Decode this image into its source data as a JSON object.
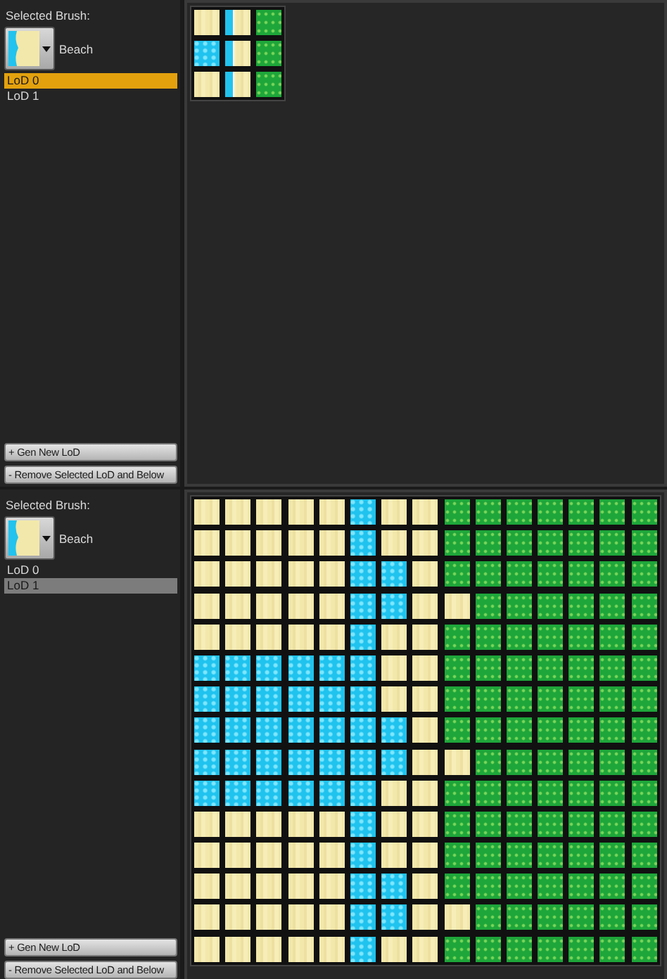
{
  "panels": [
    {
      "list_focused": true,
      "brush_label": "Selected Brush:",
      "brush": {
        "name": "Beach"
      },
      "lods": [
        {
          "label": "LoD 0",
          "selected": true
        },
        {
          "label": "LoD 1",
          "selected": false
        }
      ],
      "buttons": [
        "+ Gen New LoD",
        "- Remove Selected LoD and Below"
      ],
      "grid": [
        [
          {
            "kind": "sand"
          },
          {
            "kind": "beach"
          },
          {
            "kind": "grass"
          }
        ],
        [
          {
            "kind": "water"
          },
          {
            "kind": "beach"
          },
          {
            "kind": "grass"
          }
        ],
        [
          {
            "kind": "sand"
          },
          {
            "kind": "beach"
          },
          {
            "kind": "grass"
          }
        ]
      ]
    },
    {
      "list_focused": false,
      "brush_label": "Selected Brush:",
      "brush": {
        "name": "Beach"
      },
      "lods": [
        {
          "label": "LoD 0",
          "selected": false
        },
        {
          "label": "LoD 1",
          "selected": true
        }
      ],
      "buttons": [
        "+ Gen New LoD",
        "- Remove Selected LoD and Below"
      ],
      "grid": [
        [
          {
            "kind": "sand"
          },
          {
            "kind": "sand"
          },
          {
            "kind": "sand"
          },
          {
            "kind": "sand"
          },
          {
            "kind": "sand"
          },
          {
            "kind": "water"
          },
          {
            "kind": "sand"
          },
          {
            "kind": "sand"
          },
          {
            "kind": "grass"
          },
          {
            "kind": "grass"
          },
          {
            "kind": "grass"
          },
          {
            "kind": "grass"
          },
          {
            "kind": "grass"
          },
          {
            "kind": "grass"
          },
          {
            "kind": "grass"
          }
        ],
        [
          {
            "kind": "sand"
          },
          {
            "kind": "sand"
          },
          {
            "kind": "sand"
          },
          {
            "kind": "sand"
          },
          {
            "kind": "sand"
          },
          {
            "kind": "water"
          },
          {
            "kind": "sand"
          },
          {
            "kind": "sand"
          },
          {
            "kind": "grass"
          },
          {
            "kind": "grass"
          },
          {
            "kind": "grass"
          },
          {
            "kind": "grass"
          },
          {
            "kind": "grass"
          },
          {
            "kind": "grass"
          },
          {
            "kind": "grass"
          }
        ],
        [
          {
            "kind": "sand"
          },
          {
            "kind": "sand"
          },
          {
            "kind": "sand"
          },
          {
            "kind": "sand"
          },
          {
            "kind": "sand"
          },
          {
            "kind": "water"
          },
          {
            "kind": "water"
          },
          {
            "kind": "sand"
          },
          {
            "kind": "grass"
          },
          {
            "kind": "grass"
          },
          {
            "kind": "grass"
          },
          {
            "kind": "grass"
          },
          {
            "kind": "grass"
          },
          {
            "kind": "grass"
          },
          {
            "kind": "grass"
          }
        ],
        [
          {
            "kind": "sand"
          },
          {
            "kind": "sand"
          },
          {
            "kind": "sand"
          },
          {
            "kind": "sand"
          },
          {
            "kind": "sand"
          },
          {
            "kind": "water"
          },
          {
            "kind": "water"
          },
          {
            "kind": "sand"
          },
          {
            "kind": "sand"
          },
          {
            "kind": "grass"
          },
          {
            "kind": "grass"
          },
          {
            "kind": "grass"
          },
          {
            "kind": "grass"
          },
          {
            "kind": "grass"
          },
          {
            "kind": "grass"
          }
        ],
        [
          {
            "kind": "sand"
          },
          {
            "kind": "sand"
          },
          {
            "kind": "sand"
          },
          {
            "kind": "sand"
          },
          {
            "kind": "sand"
          },
          {
            "kind": "water"
          },
          {
            "kind": "sand"
          },
          {
            "kind": "sand"
          },
          {
            "kind": "grass"
          },
          {
            "kind": "grass"
          },
          {
            "kind": "grass"
          },
          {
            "kind": "grass"
          },
          {
            "kind": "grass"
          },
          {
            "kind": "grass"
          },
          {
            "kind": "grass"
          }
        ],
        [
          {
            "kind": "water"
          },
          {
            "kind": "water"
          },
          {
            "kind": "water"
          },
          {
            "kind": "water"
          },
          {
            "kind": "water"
          },
          {
            "kind": "water"
          },
          {
            "kind": "sand"
          },
          {
            "kind": "sand"
          },
          {
            "kind": "grass"
          },
          {
            "kind": "grass"
          },
          {
            "kind": "grass"
          },
          {
            "kind": "grass"
          },
          {
            "kind": "grass"
          },
          {
            "kind": "grass"
          },
          {
            "kind": "grass"
          }
        ],
        [
          {
            "kind": "water"
          },
          {
            "kind": "water"
          },
          {
            "kind": "water"
          },
          {
            "kind": "water"
          },
          {
            "kind": "water"
          },
          {
            "kind": "water"
          },
          {
            "kind": "sand"
          },
          {
            "kind": "sand"
          },
          {
            "kind": "grass"
          },
          {
            "kind": "grass"
          },
          {
            "kind": "grass"
          },
          {
            "kind": "grass"
          },
          {
            "kind": "grass"
          },
          {
            "kind": "grass"
          },
          {
            "kind": "grass"
          }
        ],
        [
          {
            "kind": "water"
          },
          {
            "kind": "water"
          },
          {
            "kind": "water"
          },
          {
            "kind": "water"
          },
          {
            "kind": "water"
          },
          {
            "kind": "water"
          },
          {
            "kind": "water"
          },
          {
            "kind": "sand"
          },
          {
            "kind": "grass"
          },
          {
            "kind": "grass"
          },
          {
            "kind": "grass"
          },
          {
            "kind": "grass"
          },
          {
            "kind": "grass"
          },
          {
            "kind": "grass"
          },
          {
            "kind": "grass"
          }
        ],
        [
          {
            "kind": "water"
          },
          {
            "kind": "water"
          },
          {
            "kind": "water"
          },
          {
            "kind": "water"
          },
          {
            "kind": "water"
          },
          {
            "kind": "water"
          },
          {
            "kind": "water"
          },
          {
            "kind": "sand"
          },
          {
            "kind": "sand"
          },
          {
            "kind": "grass"
          },
          {
            "kind": "grass"
          },
          {
            "kind": "grass"
          },
          {
            "kind": "grass"
          },
          {
            "kind": "grass"
          },
          {
            "kind": "grass"
          }
        ],
        [
          {
            "kind": "water"
          },
          {
            "kind": "water"
          },
          {
            "kind": "water"
          },
          {
            "kind": "water"
          },
          {
            "kind": "water"
          },
          {
            "kind": "water"
          },
          {
            "kind": "sand"
          },
          {
            "kind": "sand"
          },
          {
            "kind": "grass"
          },
          {
            "kind": "grass"
          },
          {
            "kind": "grass"
          },
          {
            "kind": "grass"
          },
          {
            "kind": "grass"
          },
          {
            "kind": "grass"
          },
          {
            "kind": "grass"
          }
        ],
        [
          {
            "kind": "sand"
          },
          {
            "kind": "sand"
          },
          {
            "kind": "sand"
          },
          {
            "kind": "sand"
          },
          {
            "kind": "sand"
          },
          {
            "kind": "water"
          },
          {
            "kind": "sand"
          },
          {
            "kind": "sand"
          },
          {
            "kind": "grass"
          },
          {
            "kind": "grass"
          },
          {
            "kind": "grass"
          },
          {
            "kind": "grass"
          },
          {
            "kind": "grass"
          },
          {
            "kind": "grass"
          },
          {
            "kind": "grass"
          }
        ],
        [
          {
            "kind": "sand"
          },
          {
            "kind": "sand"
          },
          {
            "kind": "sand"
          },
          {
            "kind": "sand"
          },
          {
            "kind": "sand"
          },
          {
            "kind": "water"
          },
          {
            "kind": "sand"
          },
          {
            "kind": "sand"
          },
          {
            "kind": "grass"
          },
          {
            "kind": "grass"
          },
          {
            "kind": "grass"
          },
          {
            "kind": "grass"
          },
          {
            "kind": "grass"
          },
          {
            "kind": "grass"
          },
          {
            "kind": "grass"
          }
        ],
        [
          {
            "kind": "sand"
          },
          {
            "kind": "sand"
          },
          {
            "kind": "sand"
          },
          {
            "kind": "sand"
          },
          {
            "kind": "sand"
          },
          {
            "kind": "water"
          },
          {
            "kind": "water"
          },
          {
            "kind": "sand"
          },
          {
            "kind": "grass"
          },
          {
            "kind": "grass"
          },
          {
            "kind": "grass"
          },
          {
            "kind": "grass"
          },
          {
            "kind": "grass"
          },
          {
            "kind": "grass"
          },
          {
            "kind": "grass"
          }
        ],
        [
          {
            "kind": "sand"
          },
          {
            "kind": "sand"
          },
          {
            "kind": "sand"
          },
          {
            "kind": "sand"
          },
          {
            "kind": "sand"
          },
          {
            "kind": "water"
          },
          {
            "kind": "water"
          },
          {
            "kind": "sand"
          },
          {
            "kind": "sand"
          },
          {
            "kind": "grass"
          },
          {
            "kind": "grass"
          },
          {
            "kind": "grass"
          },
          {
            "kind": "grass"
          },
          {
            "kind": "grass"
          },
          {
            "kind": "grass"
          }
        ],
        [
          {
            "kind": "sand"
          },
          {
            "kind": "sand"
          },
          {
            "kind": "sand"
          },
          {
            "kind": "sand"
          },
          {
            "kind": "sand"
          },
          {
            "kind": "water"
          },
          {
            "kind": "sand"
          },
          {
            "kind": "sand"
          },
          {
            "kind": "grass"
          },
          {
            "kind": "grass"
          },
          {
            "kind": "grass"
          },
          {
            "kind": "grass"
          },
          {
            "kind": "grass"
          },
          {
            "kind": "grass"
          },
          {
            "kind": "grass"
          }
        ]
      ]
    }
  ]
}
